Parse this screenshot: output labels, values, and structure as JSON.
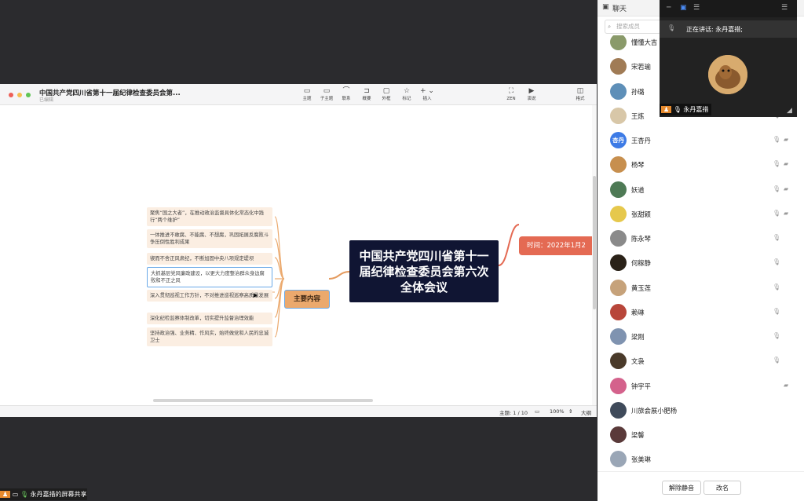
{
  "app": {
    "doc_title": "中国共产党四川省第十一届纪律检查委员会第...",
    "doc_status": "已编辑",
    "toolbar": [
      {
        "name": "topic",
        "label": "主题",
        "icon": "▭"
      },
      {
        "name": "subtopic",
        "label": "子主题",
        "icon": "▭"
      },
      {
        "name": "relationship",
        "label": "联系",
        "icon": "⌒"
      },
      {
        "name": "summary",
        "label": "概要",
        "icon": "⊐"
      },
      {
        "name": "boundary",
        "label": "外框",
        "icon": "▢"
      },
      {
        "name": "marker",
        "label": "标记",
        "icon": "☆"
      },
      {
        "name": "insert",
        "label": "插入",
        "icon": "+ ⌄"
      }
    ],
    "toolbar_right": [
      {
        "name": "zen",
        "label": "ZEN",
        "icon": "⛶"
      },
      {
        "name": "pitch",
        "label": "演说",
        "icon": "▶"
      },
      {
        "name": "format",
        "label": "格式",
        "icon": "◫"
      }
    ],
    "status": {
      "topic_count": "主题: 1 / 10",
      "zoom": "100%",
      "outline": "大纲"
    }
  },
  "mindmap": {
    "central_topic": "中国共产党四川省第十一届纪律检查委员会第六次全体会议",
    "main_branch": "主要内容",
    "time_branch": "时间：2022年1月2",
    "leaves": [
      "聚焦“国之大者”，在推动政治监督具体化常态化中践行“两个维护”",
      "一体推进不敢腐、不能腐、不想腐，巩固拓展反腐败斗争压倒性胜利成果",
      "锲而不舍正风肃纪，不断加固中央八项规定堤坝",
      "大抓基层党风廉政建设，以更大力度整治群众身边腐败和不正之风",
      "深入贯彻巡视工作方针，不对推进巡视巡察高质量发展",
      "深化纪检监察体制改革，切实提升监督治理效能",
      "坚持政治强、业务精、作风实，始终做党和人民的忠诚卫士"
    ]
  },
  "sidebar": {
    "chat_label": "聊天",
    "search_placeholder": "搜索成员",
    "members": [
      {
        "name": "懂懂大吉",
        "avatar_color": "#8a9a6a",
        "avatar_text": "",
        "mic": false,
        "cam": false
      },
      {
        "name": "宋若瑜",
        "avatar_color": "#a07b55",
        "avatar_text": "",
        "mic": false,
        "cam": false
      },
      {
        "name": "孙璐",
        "avatar_color": "#5e8fb8",
        "avatar_text": "",
        "mic": false,
        "cam": false
      },
      {
        "name": "王炼",
        "avatar_color": "#d8c7a8",
        "avatar_text": "",
        "mic": true,
        "cam": true
      },
      {
        "name": "王杏丹",
        "avatar_color": "#3d7be6",
        "avatar_text": "杏丹",
        "mic": true,
        "cam": true
      },
      {
        "name": "杨琴",
        "avatar_color": "#c78f4e",
        "avatar_text": "",
        "mic": true,
        "cam": true
      },
      {
        "name": "妖道",
        "avatar_color": "#4e7a55",
        "avatar_text": "",
        "mic": true,
        "cam": true
      },
      {
        "name": "张甜颖",
        "avatar_color": "#e6c84c",
        "avatar_text": "",
        "mic": true,
        "cam": true
      },
      {
        "name": "陈永琴",
        "avatar_color": "#8a8a8a",
        "avatar_text": "",
        "mic": true,
        "cam": false
      },
      {
        "name": "何稼静",
        "avatar_color": "#2a2218",
        "avatar_text": "",
        "mic": true,
        "cam": false
      },
      {
        "name": "黄玉莲",
        "avatar_color": "#c6a27a",
        "avatar_text": "",
        "mic": true,
        "cam": false
      },
      {
        "name": "赖琳",
        "avatar_color": "#b8463a",
        "avatar_text": "",
        "mic": true,
        "cam": false
      },
      {
        "name": "梁刚",
        "avatar_color": "#7f93b0",
        "avatar_text": "",
        "mic": true,
        "cam": false
      },
      {
        "name": "文袅",
        "avatar_color": "#4a3a2a",
        "avatar_text": "",
        "mic": true,
        "cam": false
      },
      {
        "name": "钟宇平",
        "avatar_color": "#d4628c",
        "avatar_text": "",
        "mic": false,
        "cam": true
      },
      {
        "name": "川旅会展小肥杨",
        "avatar_color": "#3f4a5a",
        "avatar_text": "",
        "mic": false,
        "cam": false
      },
      {
        "name": "梁馨",
        "avatar_color": "#5a3a3a",
        "avatar_text": "",
        "mic": false,
        "cam": false
      },
      {
        "name": "张美琳",
        "avatar_color": "#9aa6b6",
        "avatar_text": "",
        "mic": false,
        "cam": false
      }
    ],
    "unmute_all_label": "解除静音",
    "rename_label": "改名"
  },
  "speaker": {
    "speaking_text": "正在讲话: 永丹嘉措;",
    "name": "永丹嘉措"
  },
  "share_bar": {
    "text": "永丹嘉措的屏幕共享"
  }
}
